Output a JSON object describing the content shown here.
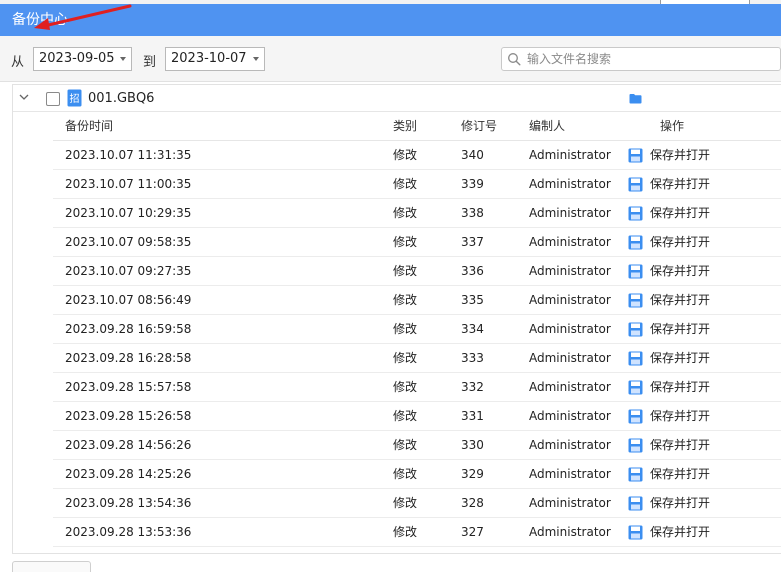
{
  "dialog": {
    "title": "备份中心"
  },
  "filters": {
    "from_label": "从",
    "from_date": "2023-09-05",
    "to_label": "到",
    "to_date": "2023-10-07",
    "search_placeholder": "输入文件名搜索"
  },
  "file": {
    "name": "001.GBQ6",
    "expanded": true,
    "checked": false
  },
  "table": {
    "headers": {
      "time": "备份时间",
      "type": "类别",
      "revision": "修订号",
      "editor": "编制人",
      "action": "操作"
    },
    "action_label": "保存并打开",
    "rows": [
      {
        "time": "2023.10.07 11:31:35",
        "type": "修改",
        "revision": "340",
        "editor": "Administrator"
      },
      {
        "time": "2023.10.07 11:00:35",
        "type": "修改",
        "revision": "339",
        "editor": "Administrator"
      },
      {
        "time": "2023.10.07 10:29:35",
        "type": "修改",
        "revision": "338",
        "editor": "Administrator"
      },
      {
        "time": "2023.10.07 09:58:35",
        "type": "修改",
        "revision": "337",
        "editor": "Administrator"
      },
      {
        "time": "2023.10.07 09:27:35",
        "type": "修改",
        "revision": "336",
        "editor": "Administrator"
      },
      {
        "time": "2023.10.07 08:56:49",
        "type": "修改",
        "revision": "335",
        "editor": "Administrator"
      },
      {
        "time": "2023.09.28 16:59:58",
        "type": "修改",
        "revision": "334",
        "editor": "Administrator"
      },
      {
        "time": "2023.09.28 16:28:58",
        "type": "修改",
        "revision": "333",
        "editor": "Administrator"
      },
      {
        "time": "2023.09.28 15:57:58",
        "type": "修改",
        "revision": "332",
        "editor": "Administrator"
      },
      {
        "time": "2023.09.28 15:26:58",
        "type": "修改",
        "revision": "331",
        "editor": "Administrator"
      },
      {
        "time": "2023.09.28 14:56:26",
        "type": "修改",
        "revision": "330",
        "editor": "Administrator"
      },
      {
        "time": "2023.09.28 14:25:26",
        "type": "修改",
        "revision": "329",
        "editor": "Administrator"
      },
      {
        "time": "2023.09.28 13:54:36",
        "type": "修改",
        "revision": "328",
        "editor": "Administrator"
      },
      {
        "time": "2023.09.28 13:53:36",
        "type": "修改",
        "revision": "327",
        "editor": "Administrator"
      }
    ]
  },
  "colors": {
    "titlebar": "#4f93f1",
    "accent_icon": "#3b8ef0",
    "annotation_arrow": "#e02020"
  },
  "icons": {
    "search": "search-icon",
    "save": "save-icon",
    "folder": "folder-icon",
    "file": "gbq-file-icon",
    "expand": "chevron-down-icon"
  }
}
